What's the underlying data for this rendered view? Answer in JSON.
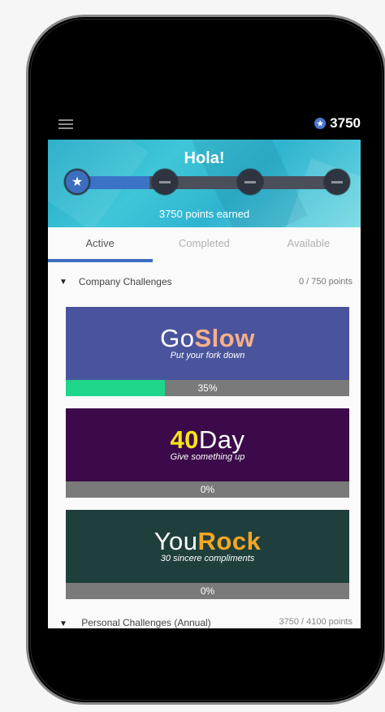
{
  "header": {
    "points": "3750"
  },
  "hero": {
    "greeting": "Hola!",
    "points_earned": "3750 points earned",
    "progress_fraction": 0.28
  },
  "tabs": [
    {
      "label": "Active",
      "active": true
    },
    {
      "label": "Completed",
      "active": false
    },
    {
      "label": "Available",
      "active": false
    }
  ],
  "company_section": {
    "title": "Company Challenges",
    "points": "0 / 750 points"
  },
  "challenges": [
    {
      "brand_light": "Go",
      "brand_bold": "Slow",
      "tagline": "Put your fork down",
      "progress_label": "35%",
      "progress": 0.35,
      "bg": "#4a549d",
      "bold_color": "#f6b08a"
    },
    {
      "brand_bold": "40",
      "brand_light": "Day",
      "tagline": "Give something up",
      "progress_label": "0%",
      "progress": 0,
      "bg": "#3c0a4a",
      "bold_color": "#f8e419"
    },
    {
      "brand_light": "You",
      "brand_bold": "Rock",
      "tagline": "30 sincere compliments",
      "progress_label": "0%",
      "progress": 0,
      "bg": "#1f3f3d",
      "bold_color": "#f6a623"
    }
  ],
  "personal_section": {
    "title": "Personal Challenges (Annual)",
    "points": "3750 / 4100 points"
  },
  "colors": {
    "accent": "#3c6ec0",
    "progress_green": "#1ed68a"
  }
}
